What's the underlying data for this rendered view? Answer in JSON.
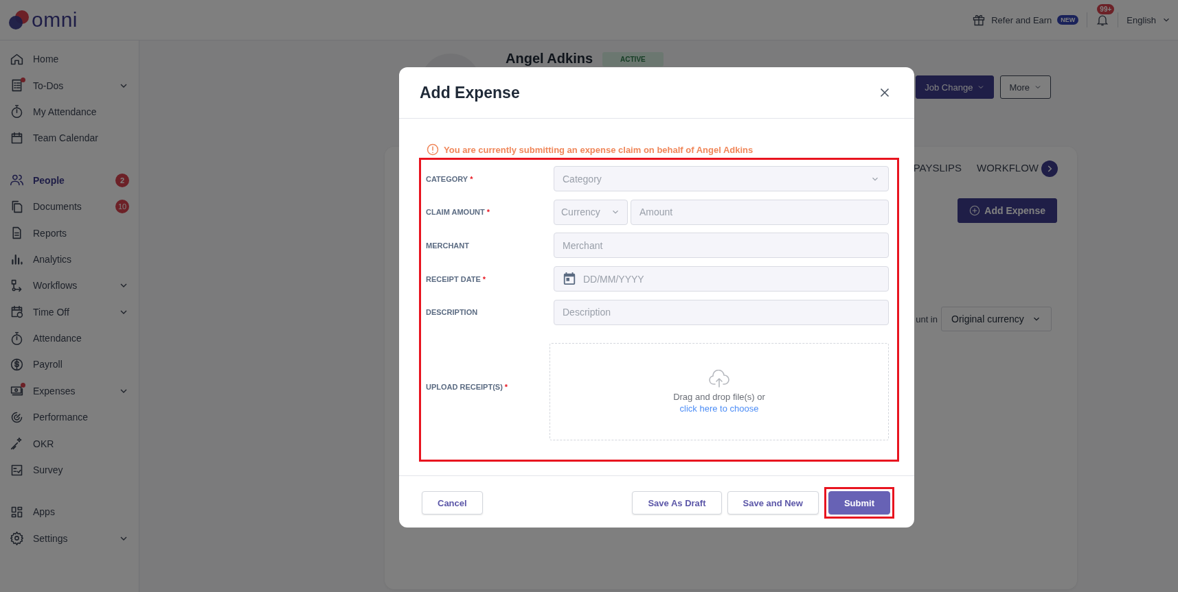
{
  "header": {
    "logo": "omni",
    "refer": "Refer and Earn",
    "refer_badge": "NEW",
    "notification_badge": "99+",
    "language": "English"
  },
  "sidebar": {
    "sections": [
      [
        {
          "label": "Home",
          "selected": false,
          "alert": false,
          "kind": "link"
        },
        {
          "label": "To-Dos",
          "selected": false,
          "alert": true,
          "kind": "group"
        },
        {
          "label": "My Attendance",
          "selected": false,
          "alert": false,
          "kind": "link"
        },
        {
          "label": "Team Calendar",
          "selected": false,
          "alert": false,
          "kind": "link"
        }
      ],
      [
        {
          "label": "People",
          "selected": true,
          "alert": false,
          "kind": "link",
          "badge": "2"
        },
        {
          "label": "Documents",
          "selected": false,
          "alert": false,
          "kind": "link",
          "badge": "10"
        },
        {
          "label": "Reports",
          "selected": false,
          "alert": false,
          "kind": "link"
        },
        {
          "label": "Analytics",
          "selected": false,
          "alert": false,
          "kind": "link"
        },
        {
          "label": "Workflows",
          "selected": false,
          "alert": false,
          "kind": "group"
        },
        {
          "label": "Time Off",
          "selected": false,
          "alert": false,
          "kind": "group"
        },
        {
          "label": "Attendance",
          "selected": false,
          "alert": false,
          "kind": "link"
        },
        {
          "label": "Payroll",
          "selected": false,
          "alert": false,
          "kind": "link"
        },
        {
          "label": "Expenses",
          "selected": false,
          "alert": true,
          "kind": "group"
        },
        {
          "label": "Performance",
          "selected": false,
          "alert": false,
          "kind": "link"
        },
        {
          "label": "OKR",
          "selected": false,
          "alert": false,
          "kind": "link"
        },
        {
          "label": "Survey",
          "selected": false,
          "alert": false,
          "kind": "link"
        }
      ],
      [
        {
          "label": "Apps",
          "selected": false,
          "alert": false,
          "kind": "link"
        },
        {
          "label": "Settings",
          "selected": false,
          "alert": false,
          "kind": "group"
        }
      ]
    ]
  },
  "profile": {
    "name": "Angel Adkins",
    "status": "ACTIVE",
    "actions": [
      {
        "label": "Job Change",
        "kind": "primary"
      },
      {
        "label": "More",
        "kind": "outline"
      }
    ]
  },
  "card": {
    "tabs": [
      {
        "label": "PAYSLIPS",
        "selected": false
      },
      {
        "label": "WORKFLOW",
        "selected": false
      }
    ],
    "add_button": "Add Expense",
    "currency_label": "unt in",
    "currency_select": "Original currency"
  },
  "modal": {
    "title": "Add Expense",
    "notice": "You are currently submitting an expense claim on behalf of Angel Adkins",
    "form": {
      "highlighted": true,
      "rows": [
        {
          "kind": "select",
          "label": "CATEGORY",
          "required_mark": "*",
          "placeholder": "Category"
        },
        {
          "kind": "amount",
          "label": "CLAIM AMOUNT",
          "required_mark": "*",
          "currency_placeholder": "Currency",
          "placeholder": "Amount"
        },
        {
          "kind": "text",
          "label": "MERCHANT",
          "placeholder": "Merchant"
        },
        {
          "kind": "date",
          "label": "RECEIPT DATE",
          "required_mark": "*",
          "placeholder": "DD/MM/YYYY"
        },
        {
          "kind": "text",
          "label": "DESCRIPTION",
          "placeholder": "Description"
        },
        {
          "kind": "upload",
          "label": "UPLOAD RECEIPT(S)",
          "required_mark": "*",
          "prompt": "Drag and drop file(s) or",
          "link": "click here to choose"
        }
      ]
    },
    "buttons": [
      {
        "label": "Cancel",
        "kind": "secondary",
        "highlighted": false
      },
      {
        "label": "Save As Draft",
        "kind": "secondary",
        "highlighted": false
      },
      {
        "label": "Save and New",
        "kind": "secondary",
        "highlighted": false
      },
      {
        "label": "Submit",
        "kind": "primary",
        "highlighted": true
      }
    ]
  }
}
